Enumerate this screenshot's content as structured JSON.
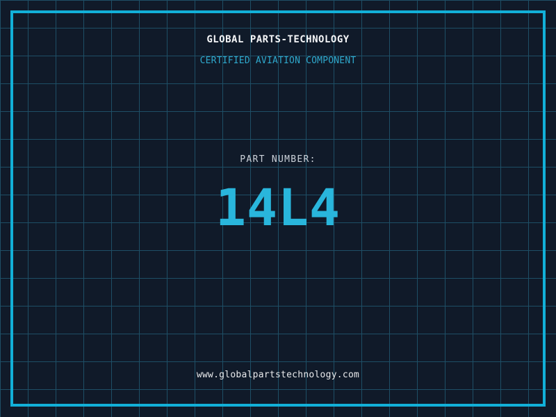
{
  "header": {
    "company_name": "GLOBAL PARTS-TECHNOLOGY",
    "subtitle": "CERTIFIED AVIATION COMPONENT"
  },
  "part": {
    "label": "PART NUMBER:",
    "number": "14L4"
  },
  "footer": {
    "website": "www.globalpartstechnology.com"
  },
  "colors": {
    "background": "#101a29",
    "grid_line": "#1e4f66",
    "frame": "#12b0d8",
    "title": "#f5f6f8",
    "subtitle": "#2fa9cd",
    "label": "#ccd2da",
    "part_number": "#29b6dc",
    "website": "#e9eaec"
  }
}
